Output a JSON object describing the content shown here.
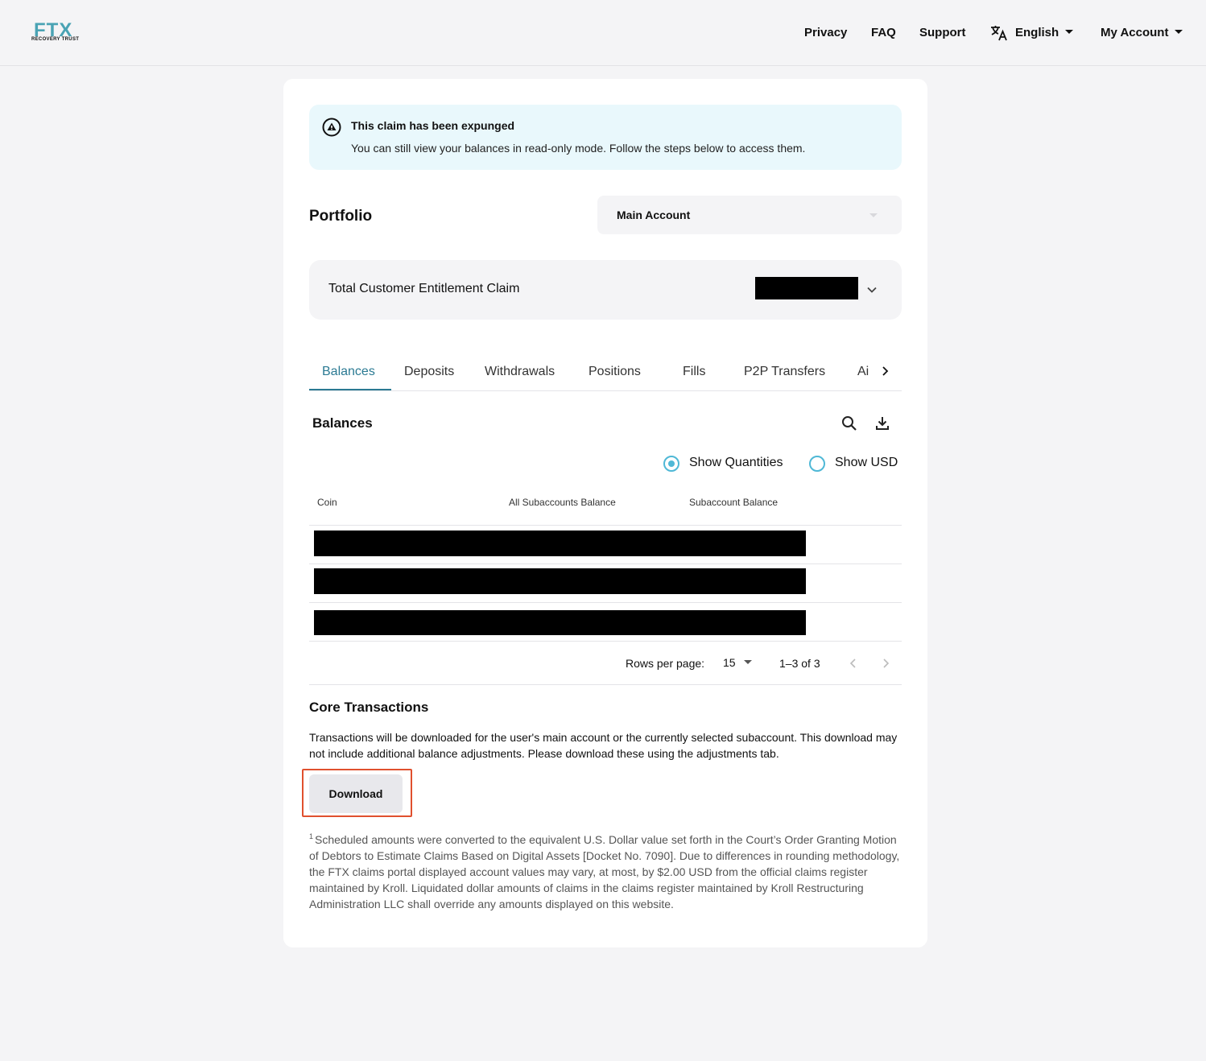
{
  "header": {
    "logo_text": "FTX",
    "logo_subtext": "RECOVERY TRUST",
    "nav": {
      "privacy": "Privacy",
      "faq": "FAQ",
      "support": "Support",
      "language": "English",
      "account": "My Account"
    }
  },
  "alert": {
    "title": "This claim has been expunged",
    "text": "You can still view your balances in read-only mode. Follow the steps below to access them."
  },
  "portfolio": {
    "title": "Portfolio",
    "account_select": "Main Account",
    "claim_label": "Total Customer Entitlement Claim"
  },
  "tabs": [
    {
      "label": "Balances",
      "active": true
    },
    {
      "label": "Deposits",
      "active": false
    },
    {
      "label": "Withdrawals",
      "active": false
    },
    {
      "label": "Positions",
      "active": false
    },
    {
      "label": "Fills",
      "active": false
    },
    {
      "label": "P2P Transfers",
      "active": false
    },
    {
      "label": "Ai",
      "active": false
    }
  ],
  "balances": {
    "title": "Balances",
    "show_quantities": "Show Quantities",
    "show_usd": "Show USD",
    "selected": "Show Quantities",
    "columns": [
      "Coin",
      "All Subaccounts Balance",
      "Subaccount Balance"
    ],
    "rows_redacted": 3
  },
  "pagination": {
    "rows_per_page_label": "Rows per page:",
    "rows_per_page": "15",
    "range": "1–3 of 3"
  },
  "core": {
    "title": "Core Transactions",
    "text": "Transactions will be downloaded for the user's main account or the currently selected subaccount. This download may not include additional balance adjustments. Please download these using the adjustments tab.",
    "download_label": "Download"
  },
  "footnote": {
    "marker": "1",
    "text": "Scheduled amounts were converted to the equivalent U.S. Dollar value set forth in the Court’s Order Granting Motion of Debtors to Estimate Claims Based on Digital Assets [Docket No. 7090]. Due to differences in rounding methodology, the FTX claims portal displayed account values may vary, at most, by $2.00 USD from the official claims register maintained by Kroll. Liquidated dollar amounts of claims in the claims register maintained by Kroll Restructuring Administration LLC shall override any amounts displayed on this website."
  },
  "colors": {
    "accent": "#2b7a93",
    "radio": "#4fb8d6",
    "alert_bg": "#e9f8fc",
    "highlight": "#e0502e"
  }
}
